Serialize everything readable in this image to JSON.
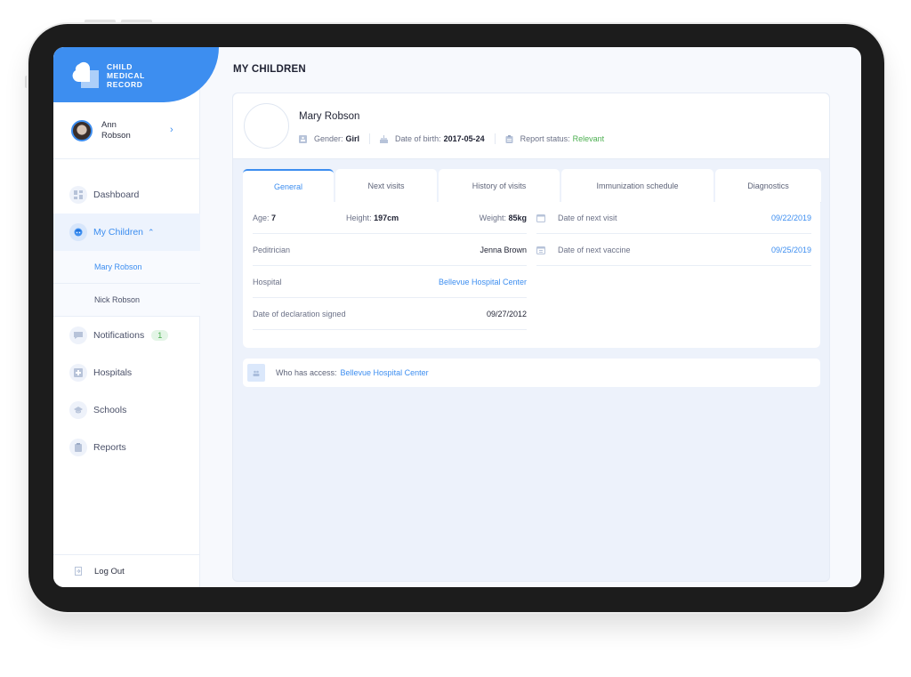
{
  "app": {
    "logo_lines": [
      "CHILD",
      "MEDICAL",
      "RECORD"
    ],
    "brand_color": "#3d8ef0"
  },
  "user": {
    "first_name": "Ann",
    "last_name": "Robson"
  },
  "sidebar": {
    "items": [
      {
        "label": "Dashboard",
        "icon": "dashboard-icon"
      },
      {
        "label": "My Children",
        "icon": "child-face-icon",
        "active": true,
        "expanded": true,
        "children": [
          {
            "label": "Mary Robson",
            "active": true
          },
          {
            "label": "Nick Robson"
          }
        ]
      },
      {
        "label": "Notifications",
        "icon": "chat-icon",
        "badge": "1"
      },
      {
        "label": "Hospitals",
        "icon": "hospital-plus-icon"
      },
      {
        "label": "Schools",
        "icon": "graduation-cap-icon"
      },
      {
        "label": "Reports",
        "icon": "clipboard-icon"
      }
    ],
    "logout_label": "Log Out"
  },
  "main": {
    "title": "MY CHILDREN",
    "child": {
      "name": "Mary Robson",
      "gender_label": "Gender:",
      "gender": "Girl",
      "dob_label": "Date of birth:",
      "dob": "2017-05-24",
      "report_label": "Report status:",
      "report_status": "Relevant",
      "report_color": "#4caf50"
    },
    "tabs": [
      {
        "label": "General",
        "active": true
      },
      {
        "label": "Next visits"
      },
      {
        "label": "History of visits"
      },
      {
        "label": "Immunization schedule"
      },
      {
        "label": "Diagnostics"
      }
    ],
    "general": {
      "age_label": "Age:",
      "age": "7",
      "height_label": "Height:",
      "height": "197cm",
      "weight_label": "Weight:",
      "weight": "85kg",
      "pediatrician_label": "Peditrician",
      "pediatrician": "Jenna Brown",
      "hospital_label": "Hospital",
      "hospital": "Bellevue Hospital Center",
      "declaration_label": "Date of declaration signed",
      "declaration": "09/27/2012",
      "next_visit_label": "Date of next visit",
      "next_visit": "09/22/2019",
      "next_vaccine_label": "Date of next vaccine",
      "next_vaccine": "09/25/2019"
    },
    "access": {
      "label": "Who has access:",
      "value": "Bellevue Hospital Center"
    }
  }
}
